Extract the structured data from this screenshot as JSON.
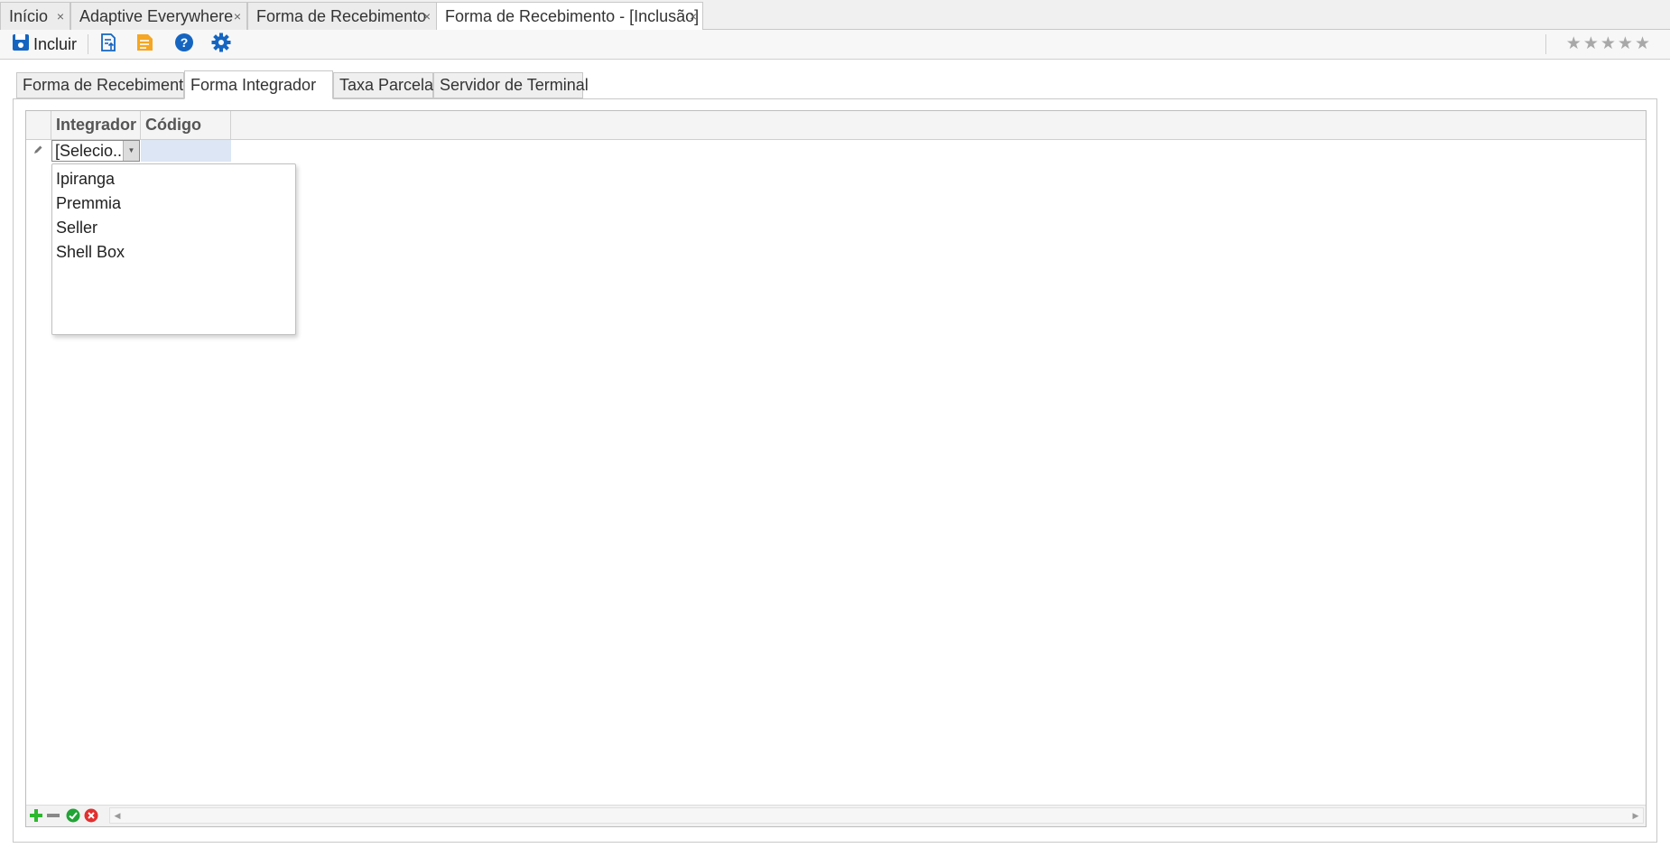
{
  "doc_tabs": [
    {
      "label": "Início",
      "close": "×"
    },
    {
      "label": "Adaptive Everywhere",
      "close": "×"
    },
    {
      "label": "Forma de Recebimento",
      "close": "×"
    },
    {
      "label": "Forma de Recebimento - [Inclusão]",
      "close": "×",
      "active": true
    }
  ],
  "toolbar": {
    "include_label": "Incluir",
    "icons": [
      "save-icon",
      "export-document-icon",
      "report-icon",
      "help-icon",
      "settings-gear-icon"
    ],
    "rating_stars": [
      "★",
      "★",
      "★",
      "★",
      "★"
    ],
    "accent_color": "#1565c0",
    "report_color": "#f5a623"
  },
  "inner_tabs": [
    {
      "label": "Forma de Recebimento"
    },
    {
      "label": "Forma Integrador",
      "active": true
    },
    {
      "label": "Taxa Parcelas"
    },
    {
      "label": "Servidor de Terminal"
    }
  ],
  "grid": {
    "columns": [
      "Integrador",
      "Código"
    ],
    "edit_row": {
      "integrador_value": "[Selecio...",
      "codigo_value": ""
    },
    "dropdown_options": [
      "Ipiranga",
      "Premmia",
      "Seller",
      "Shell Box"
    ]
  },
  "footer": {
    "icons": [
      "add-icon",
      "remove-icon",
      "confirm-icon",
      "cancel-icon"
    ],
    "add_color": "#2eb82e",
    "remove_color": "#888888",
    "confirm_color": "#21a336",
    "cancel_color": "#e03030"
  }
}
